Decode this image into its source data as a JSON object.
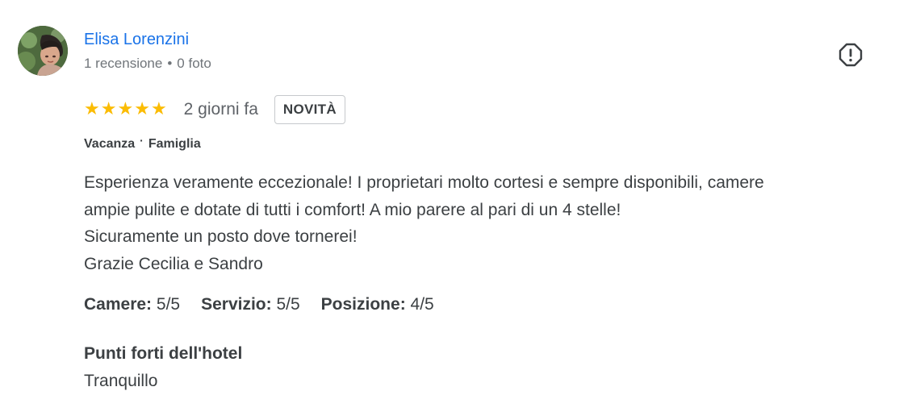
{
  "author": {
    "name": "Elisa Lorenzini",
    "reviews_count": "1 recensione",
    "meta_separator": "•",
    "photos_count": "0 foto"
  },
  "review": {
    "rating": 5,
    "stars": [
      "★",
      "★",
      "★",
      "★",
      "★"
    ],
    "time": "2 giorni fa",
    "badge": "NOVITÀ",
    "trip": {
      "type": "Vacanza",
      "separator": "·",
      "group": "Famiglia"
    },
    "text_lines": [
      "Esperienza veramente eccezionale! I proprietari molto cortesi e sempre disponibili, camere",
      "ampie pulite e dotate di tutti i comfort! A mio parere al pari di un 4 stelle!",
      "Sicuramente un posto dove tornerei!",
      "Grazie Cecilia e Sandro"
    ],
    "sub_ratings": [
      {
        "label": "Camere:",
        "value": "5/5"
      },
      {
        "label": "Servizio:",
        "value": "5/5"
      },
      {
        "label": "Posizione:",
        "value": "4/5"
      }
    ],
    "highlights": {
      "title": "Punti forti dell'hotel",
      "value": "Tranquillo"
    }
  },
  "icons": {
    "avatar": "user-avatar-photo",
    "flag": "report-flag-icon",
    "star": "star-icon"
  },
  "colors": {
    "author_link": "#1a73e8",
    "star": "#fbbc04",
    "text": "#3c4043",
    "muted": "#70757a"
  }
}
